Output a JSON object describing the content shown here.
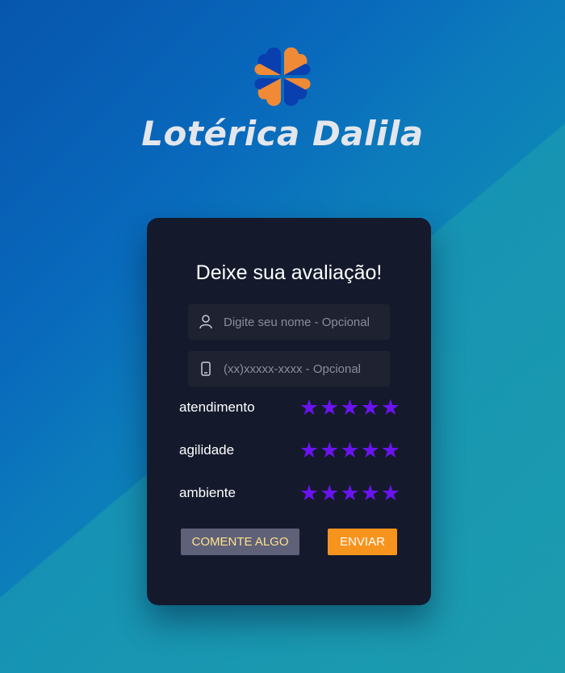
{
  "brand": {
    "name": "Lotérica Dalila"
  },
  "form": {
    "title": "Deixe sua avaliação!",
    "name_placeholder": "Digite seu nome - Opcional",
    "phone_placeholder": "(xx)xxxxx-xxxx - Opcional",
    "ratings": [
      {
        "label": "atendimento",
        "stars": 5
      },
      {
        "label": "agilidade",
        "stars": 5
      },
      {
        "label": "ambiente",
        "stars": 5
      }
    ],
    "star_glyph": "★",
    "comment_button": "COMENTE ALGO",
    "send_button": "ENVIAR"
  },
  "colors": {
    "star": "#6a12f0",
    "send_button": "#f7941d",
    "comment_button": "#5e6178",
    "card": "#141a2c",
    "logo_orange": "#f08a36",
    "logo_blue": "#0a3fb0"
  },
  "icons": [
    "clover-logo-icon",
    "user-icon",
    "phone-icon",
    "star-icon"
  ]
}
